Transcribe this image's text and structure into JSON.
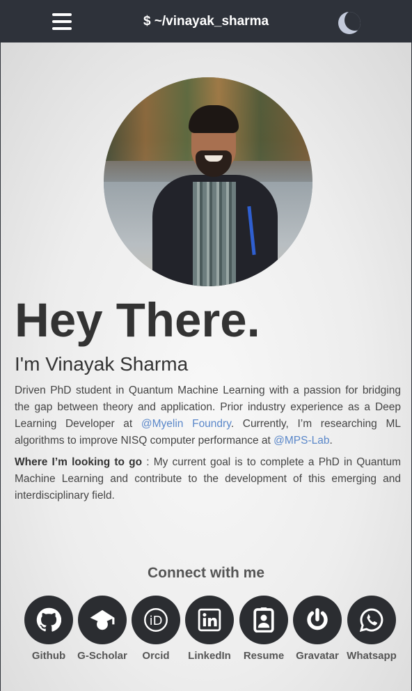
{
  "navbar": {
    "brand": "$ ~/vinayak_sharma"
  },
  "hero": {
    "greeting": "Hey There.",
    "subtitle": "I'm Vinayak Sharma",
    "bio": {
      "before_company": "Driven PhD student in Quantum Machine Learning with a passion for bridging the gap between theory and application. Prior industry experience as a Deep Learning Developer at ",
      "company_link": "@Myelin Foundry",
      "middle": ". Currently, I’m researching ML algorithms to improve NISQ computer performance at ",
      "lab_link": "@MPS-Lab",
      "after": "."
    },
    "goal": {
      "label": "Where I’m looking to go",
      "text": " : My current goal is to complete a PhD in Quantum Machine Learning and contribute to the development of this emerging and interdisciplinary field."
    }
  },
  "connect": {
    "title": "Connect with me",
    "links": [
      {
        "label": "Github",
        "icon": "github-icon"
      },
      {
        "label": "G-Scholar",
        "icon": "graduation-cap-icon"
      },
      {
        "label": "Orcid",
        "icon": "orcid-icon"
      },
      {
        "label": "LinkedIn",
        "icon": "linkedin-icon"
      },
      {
        "label": "Resume",
        "icon": "id-badge-icon"
      },
      {
        "label": "Gravatar",
        "icon": "gravatar-icon"
      },
      {
        "label": "Whatsapp",
        "icon": "whatsapp-icon"
      }
    ]
  },
  "colors": {
    "navbar": "#2e323a",
    "link": "#5a87c9",
    "social_circle": "#2b2d31",
    "heading": "#333333"
  }
}
